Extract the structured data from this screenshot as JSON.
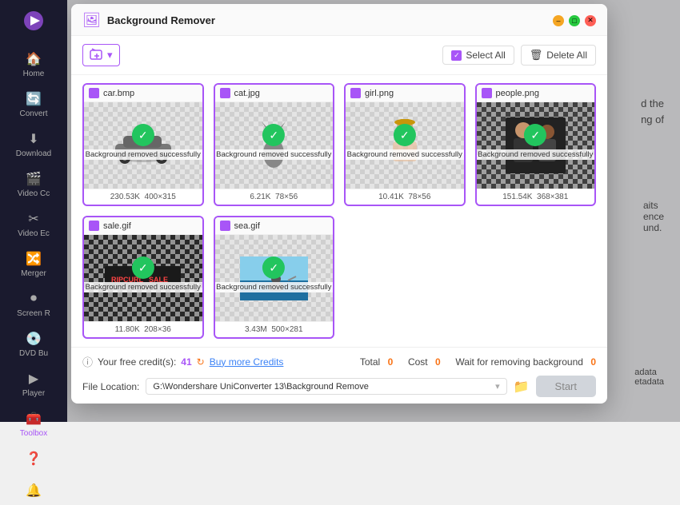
{
  "sidebar": {
    "logo_color": "#a855f7",
    "items": [
      {
        "id": "home",
        "label": "Home",
        "icon": "🏠"
      },
      {
        "id": "convert",
        "label": "Convert",
        "icon": "🔄"
      },
      {
        "id": "download",
        "label": "Download",
        "icon": "⬇"
      },
      {
        "id": "video-compress",
        "label": "Video Cc",
        "icon": "🎬"
      },
      {
        "id": "video-edit",
        "label": "Video Ec",
        "icon": "✂"
      },
      {
        "id": "merger",
        "label": "Merger",
        "icon": "🔀"
      },
      {
        "id": "screen-rec",
        "label": "Screen R",
        "icon": "⏺"
      },
      {
        "id": "dvd-burn",
        "label": "DVD Bu",
        "icon": "💿"
      },
      {
        "id": "player",
        "label": "Player",
        "icon": "▶"
      },
      {
        "id": "toolbox",
        "label": "Toolbox",
        "icon": "🧰",
        "active": true
      }
    ],
    "bottom_items": [
      {
        "id": "help",
        "icon": "❓"
      },
      {
        "id": "notifications",
        "icon": "🔔"
      }
    ]
  },
  "dialog": {
    "title": "Background Remover",
    "toolbar": {
      "add_files_label": "▾",
      "select_all_label": "Select All",
      "delete_all_label": "Delete All"
    },
    "images": [
      {
        "filename": "car.bmp",
        "filesize": "230.53K",
        "dimensions": "400×315",
        "status": "Background removed successfully",
        "type": "car"
      },
      {
        "filename": "cat.jpg",
        "filesize": "6.21K",
        "dimensions": "78×56",
        "status": "Background removed successfully",
        "type": "cat"
      },
      {
        "filename": "girl.png",
        "filesize": "10.41K",
        "dimensions": "78×56",
        "status": "Background removed successfully",
        "type": "girl"
      },
      {
        "filename": "people.png",
        "filesize": "151.54K",
        "dimensions": "368×381",
        "status": "Background removed successfully",
        "type": "people"
      },
      {
        "filename": "sale.gif",
        "filesize": "11.80K",
        "dimensions": "208×36",
        "status": "Background removed successfully",
        "type": "sale"
      },
      {
        "filename": "sea.gif",
        "filesize": "3.43M",
        "dimensions": "500×281",
        "status": "Background removed successfully",
        "type": "sea"
      }
    ],
    "bottom": {
      "credits_label": "Your free credit(s):",
      "credits_count": "41",
      "buy_label": "Buy more Credits",
      "total_label": "Total",
      "total_val": "0",
      "cost_label": "Cost",
      "cost_val": "0",
      "wait_label": "Wait for removing background",
      "wait_val": "0",
      "file_loc_label": "File Location:",
      "file_path": "G:\\Wondershare UniConverter 13\\Background Remove",
      "start_label": "Start"
    }
  }
}
